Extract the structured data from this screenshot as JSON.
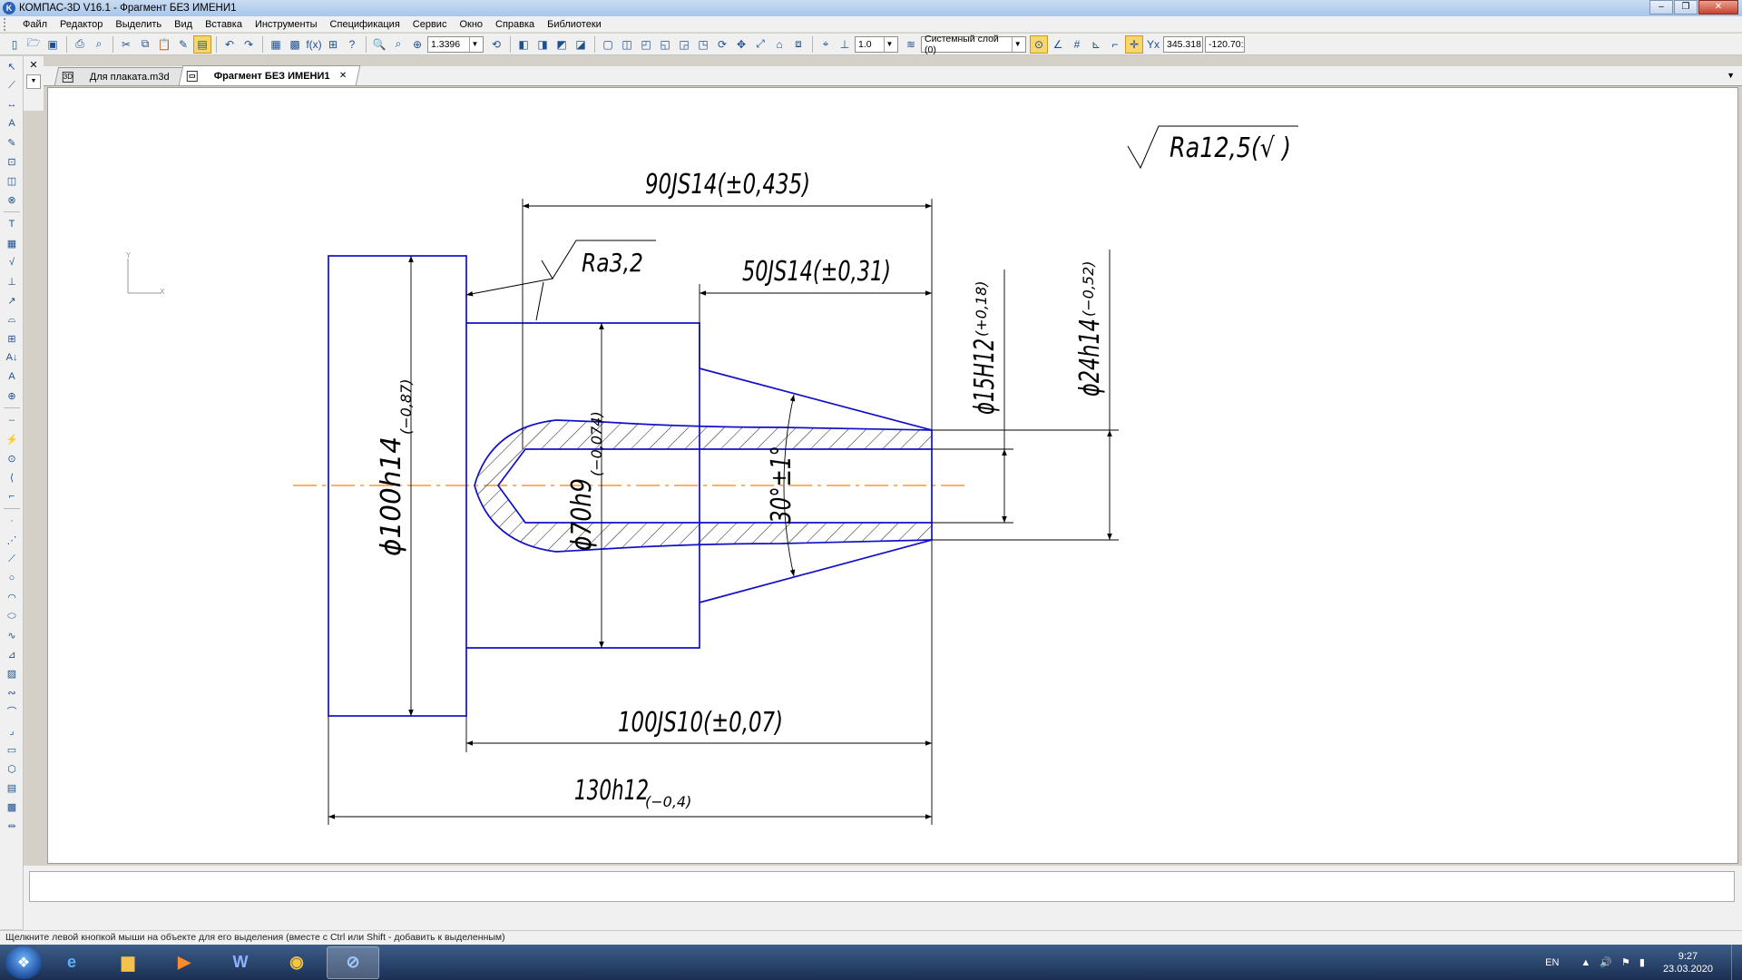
{
  "window": {
    "title": "КОМПАС-3D V16.1 - Фрагмент БЕЗ ИМЕНИ1",
    "min_glyph": "–",
    "restore_glyph": "❐",
    "close_glyph": "✕"
  },
  "menu": [
    "Файл",
    "Редактор",
    "Выделить",
    "Вид",
    "Вставка",
    "Инструменты",
    "Спецификация",
    "Сервис",
    "Окно",
    "Справка",
    "Библиотеки"
  ],
  "toolbar": {
    "zoom_value": "1.3396",
    "step_value": "1.0",
    "layer": "Системный слой (0)",
    "coord_x": "345.318",
    "coord_y": "-120.70:"
  },
  "tabs": [
    {
      "label": "Для плаката.m3d",
      "active": false,
      "icon": "3D"
    },
    {
      "label": "Фрагмент БЕЗ ИМЕНИ1",
      "active": true,
      "icon": "▭"
    }
  ],
  "drawing": {
    "axis_y": "Y",
    "axis_x": "X",
    "roughness_general": "Ra12,5(√ )",
    "roughness_face": "Ra3,2",
    "dim_90": "90JS14(±0,435)",
    "dim_50": "50JS14(±0,31)",
    "dim_100_len": "100JS10(±0,07)",
    "dim_130_main": "130h12",
    "dim_130_tol": "(−0,4)",
    "dim_d100_main": "ϕ100h14",
    "dim_d100_tol": "(−0,87)",
    "dim_d70_main": "ϕ70h9",
    "dim_d70_tol": "(−0,074)",
    "dim_d15_main": "ϕ15H12",
    "dim_d15_tol": "(+0,18)",
    "dim_d24_main": "ϕ24h14",
    "dim_d24_tol": "(−0,52)",
    "dim_angle": "30°±1°"
  },
  "status": {
    "hint": "Щелкните левой кнопкой мыши на объекте для его выделения (вместе с Ctrl или Shift - добавить к выделенным)"
  },
  "taskbar": {
    "lang": "EN",
    "time": "9:27",
    "date": "23.03.2020"
  },
  "colors": {
    "outline": "#1010c8",
    "axis": "#ff8000",
    "dim": "#000000",
    "selection": "#f8d56d"
  }
}
